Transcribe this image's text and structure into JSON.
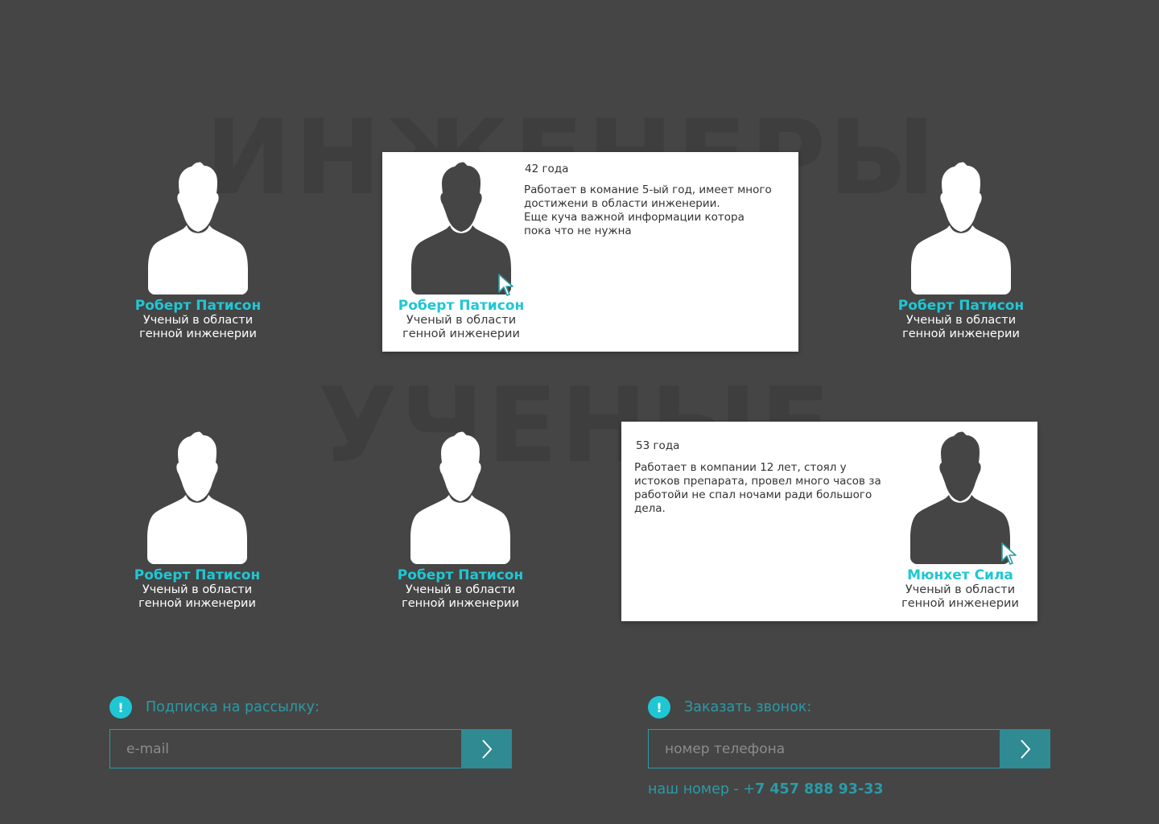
{
  "background_words": [
    "ИНЖЕНЕРЫ",
    "УЧЕНЫЕ"
  ],
  "people": [
    {
      "name": "Роберт Патисон",
      "role_line1": "Ученый в области",
      "role_line2": "генной инженерии"
    },
    {
      "name": "Роберт Патисон",
      "role_line1": "Ученый в области",
      "role_line2": "генной инженерии",
      "age": "42 года",
      "desc": [
        "Работает в комание 5-ый год, имеет много",
        "достижени в области инженерии.",
        "Еще куча важной информации котора",
        "пока что не нужна"
      ]
    },
    {
      "name": "Роберт Патисон",
      "role_line1": "Ученый в области",
      "role_line2": "генной инженерии"
    },
    {
      "name": "Роберт Патисон",
      "role_line1": "Ученый в области",
      "role_line2": "генной инженерии"
    },
    {
      "name": "Роберт Патисон",
      "role_line1": "Ученый в области",
      "role_line2": "генной инженерии"
    },
    {
      "name": "Мюнхет Сила",
      "role_line1": "Ученый в области",
      "role_line2": "генной инженерии",
      "age": "53 года",
      "desc": [
        "Работает в компании 12 лет, стоял у",
        "истоков препарата, провел много часов за",
        "работойи не спал ночами ради большого",
        "дела."
      ]
    }
  ],
  "newsletter": {
    "icon": "alert-icon",
    "icon_glyph": "!",
    "label": "Подписка на рассылку:",
    "placeholder": "e-mail",
    "button_icon": "chevron-right-icon"
  },
  "callback": {
    "icon": "alert-icon",
    "icon_glyph": "!",
    "label": "Заказать звонок:",
    "placeholder": "номер телефона",
    "button_icon": "chevron-right-icon",
    "phone_prefix": "наш номер - +",
    "phone_number": "7 457 888 93-33"
  },
  "colors": {
    "background": "#454545",
    "accent": "#1fc7d4",
    "accent_dark": "#2f8a92",
    "avatar_light": "#ffffff",
    "avatar_dark": "#454545"
  }
}
